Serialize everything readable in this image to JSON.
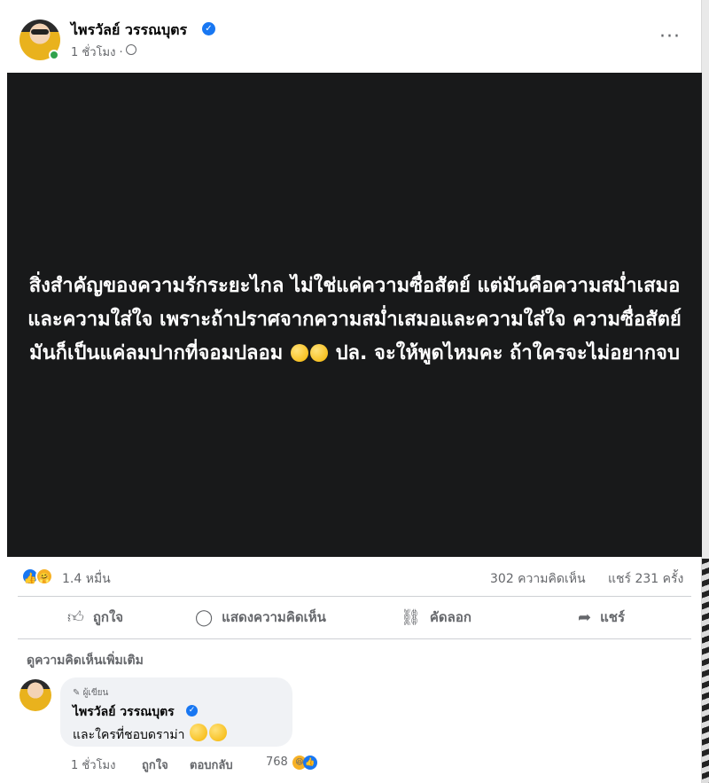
{
  "post": {
    "author": "ไพรวัลย์ วรรณบุตร",
    "time": "1 ชั่วโมง ·",
    "text": "สิ่งสำคัญของความรักระยะไกล ไม่ใช่แค่ความซื่อสัตย์ แต่มันคือความสม่ำเสมอและความใส่ใจ เพราะถ้าปราศจากความสม่ำเสมอและความใส่ใจ ความซื่อสัตย์มันก็เป็นแค่ลมปากที่จอมปลอม",
    "text_after_emoji": "ปล. จะให้พูดไหมคะ ถ้าใครจะไม่อยากจบ"
  },
  "stats": {
    "reactions": "1.4 หมื่น",
    "comments": "302 ความคิดเห็น",
    "shares": "แชร์ 231 ครั้ง"
  },
  "actions": {
    "like": "ถูกใจ",
    "comment": "แสดงความคิดเห็น",
    "copy": "คัดลอก",
    "share": "แชร์"
  },
  "comments": {
    "more_label": "ดูความคิดเห็นเพิ่มเติม",
    "items": [
      {
        "badge": "ผู้เขียน",
        "author": "ไพรวัลย์ วรรณบุตร",
        "text": "และใครที่ชอบดราม่า",
        "time": "1 ชั่วโมง",
        "like_label": "ถูกใจ",
        "reply_label": "ตอบกลับ",
        "reactions": "768"
      }
    ]
  },
  "icons": {
    "verified": "verified-check-icon",
    "globe": "globe-icon",
    "more": "more-horizontal-icon",
    "like": "thumbs-up-icon",
    "comment": "comment-bubble-icon",
    "copy": "link-icon",
    "share": "share-arrow-icon"
  },
  "colors": {
    "post_background": "#18191a",
    "brand_blue": "#1877f2",
    "secondary_text": "#65676b"
  }
}
